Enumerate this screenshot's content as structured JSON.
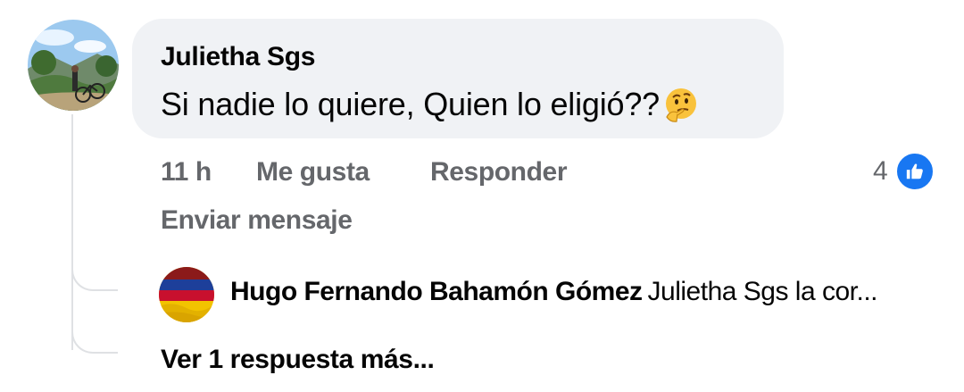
{
  "comment": {
    "author": "Julietha Sgs",
    "text": "Si nadie lo quiere, Quien lo eligió??",
    "emoji": "thinking-face",
    "time": "11 h",
    "like_label": "Me gusta",
    "reply_label": "Responder",
    "message_label": "Enviar mensaje",
    "reaction_count": "4",
    "reaction_type": "like"
  },
  "reply": {
    "author": "Hugo Fernando Bahamón Gómez",
    "preview": "Julietha Sgs la cor..."
  },
  "more_replies_label": "Ver 1 respuesta más...",
  "colors": {
    "bubble": "#f0f2f5",
    "secondary_text": "#65676b",
    "like_blue": "#1877f2",
    "flag_yellow": "#f2c300",
    "flag_blue": "#1d3f9a",
    "flag_red": "#c8102e"
  }
}
